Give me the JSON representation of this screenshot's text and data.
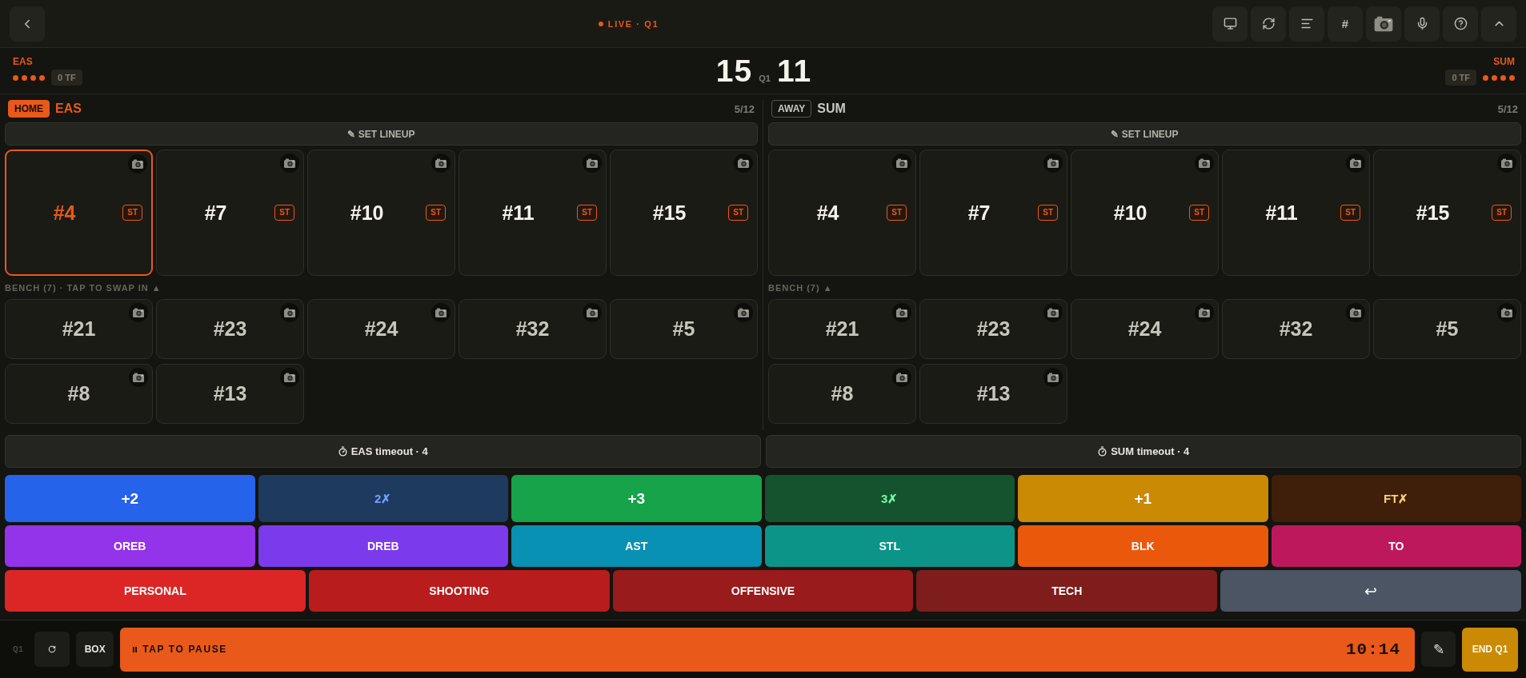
{
  "top_bar": {
    "status": "LIVE · Q1",
    "hash_button": "#"
  },
  "scoreboard": {
    "teams": [
      {
        "name": "EAS",
        "timeout_dots": [
          {
            "used": false
          },
          {
            "used": false
          },
          {
            "used": false
          },
          {
            "used": false
          }
        ],
        "fouls": "0 TF"
      },
      {
        "name": "SUM",
        "timeout_dots": [
          {
            "used": false
          },
          {
            "used": false
          },
          {
            "used": false
          },
          {
            "used": false
          }
        ],
        "fouls": "0 TF"
      }
    ],
    "home_score": "15",
    "period": "Q1",
    "away_score": "11"
  },
  "teams": [
    {
      "badge": "HOME",
      "name": "EAS",
      "selected": true,
      "count": "5/12",
      "lineup_button": "✎ SET LINEUP",
      "starters": [
        {
          "number": "#4",
          "tag": "ST",
          "selected": true
        },
        {
          "number": "#7",
          "tag": "ST",
          "selected": false
        },
        {
          "number": "#10",
          "tag": "ST",
          "selected": false
        },
        {
          "number": "#11",
          "tag": "ST",
          "selected": false
        },
        {
          "number": "#15",
          "tag": "ST",
          "selected": false
        }
      ],
      "bench_label": "BENCH (7) · TAP TO SWAP IN ▲",
      "bench": [
        {
          "number": "#21",
          "selected": false
        },
        {
          "number": "#23",
          "selected": false
        },
        {
          "number": "#24",
          "selected": false
        },
        {
          "number": "#32",
          "selected": false
        },
        {
          "number": "#5",
          "selected": false
        },
        {
          "number": "#8",
          "selected": false
        },
        {
          "number": "#13",
          "selected": false
        }
      ]
    },
    {
      "badge": "AWAY",
      "name": "SUM",
      "selected": false,
      "count": "5/12",
      "lineup_button": "✎ SET LINEUP",
      "starters": [
        {
          "number": "#4",
          "tag": "ST",
          "selected": false
        },
        {
          "number": "#7",
          "tag": "ST",
          "selected": false
        },
        {
          "number": "#10",
          "tag": "ST",
          "selected": false
        },
        {
          "number": "#11",
          "tag": "ST",
          "selected": false
        },
        {
          "number": "#15",
          "tag": "ST",
          "selected": false
        }
      ],
      "bench_label": "BENCH (7) ▲",
      "bench": [
        {
          "number": "#21",
          "selected": false
        },
        {
          "number": "#23",
          "selected": false
        },
        {
          "number": "#24",
          "selected": false
        },
        {
          "number": "#32",
          "selected": false
        },
        {
          "number": "#5",
          "selected": false
        },
        {
          "number": "#8",
          "selected": false
        },
        {
          "number": "#13",
          "selected": false
        }
      ]
    }
  ],
  "timeout_buttons": [
    "EAS timeout · 4",
    "SUM timeout · 4"
  ],
  "stat_buttons": [
    [
      {
        "label": "+2",
        "kind": "make",
        "color": "#2563eb"
      },
      {
        "label": "2✗",
        "kind": "miss",
        "color": "#1e3a5f"
      },
      {
        "label": "+3",
        "kind": "make",
        "color": "#16a34a"
      },
      {
        "label": "3✗",
        "kind": "miss",
        "color": "#14532d"
      },
      {
        "label": "+1",
        "kind": "make",
        "color": "#ca8a04"
      },
      {
        "label": "FT✗",
        "kind": "miss",
        "color": "#3f1f0a"
      }
    ],
    [
      {
        "label": "OREB",
        "kind": "stat",
        "color": "#9333ea"
      },
      {
        "label": "DREB",
        "kind": "stat",
        "color": "#7c3aed"
      },
      {
        "label": "AST",
        "kind": "stat",
        "color": "#0891b2"
      },
      {
        "label": "STL",
        "kind": "stat",
        "color": "#0d9488"
      },
      {
        "label": "BLK",
        "kind": "stat",
        "color": "#ea580c"
      },
      {
        "label": "TO",
        "kind": "stat",
        "color": "#be185d"
      }
    ],
    [
      {
        "label": "PERSONAL",
        "kind": "foul",
        "color": "#dc2626"
      },
      {
        "label": "SHOOTING",
        "kind": "foul",
        "color": "#b91c1c"
      },
      {
        "label": "OFFENSIVE",
        "kind": "foul",
        "color": "#991b1b"
      },
      {
        "label": "TECH",
        "kind": "foul",
        "color": "#7f1d1d"
      },
      {
        "label": "↩",
        "kind": "undo",
        "color": "#4b5563"
      }
    ]
  ],
  "bottom_bar": {
    "period": "Q1",
    "box_button": "BOX",
    "pause_label": "TAP TO PAUSE",
    "clock": "10:14",
    "edit_button": "✎",
    "end_button": "END Q1"
  }
}
